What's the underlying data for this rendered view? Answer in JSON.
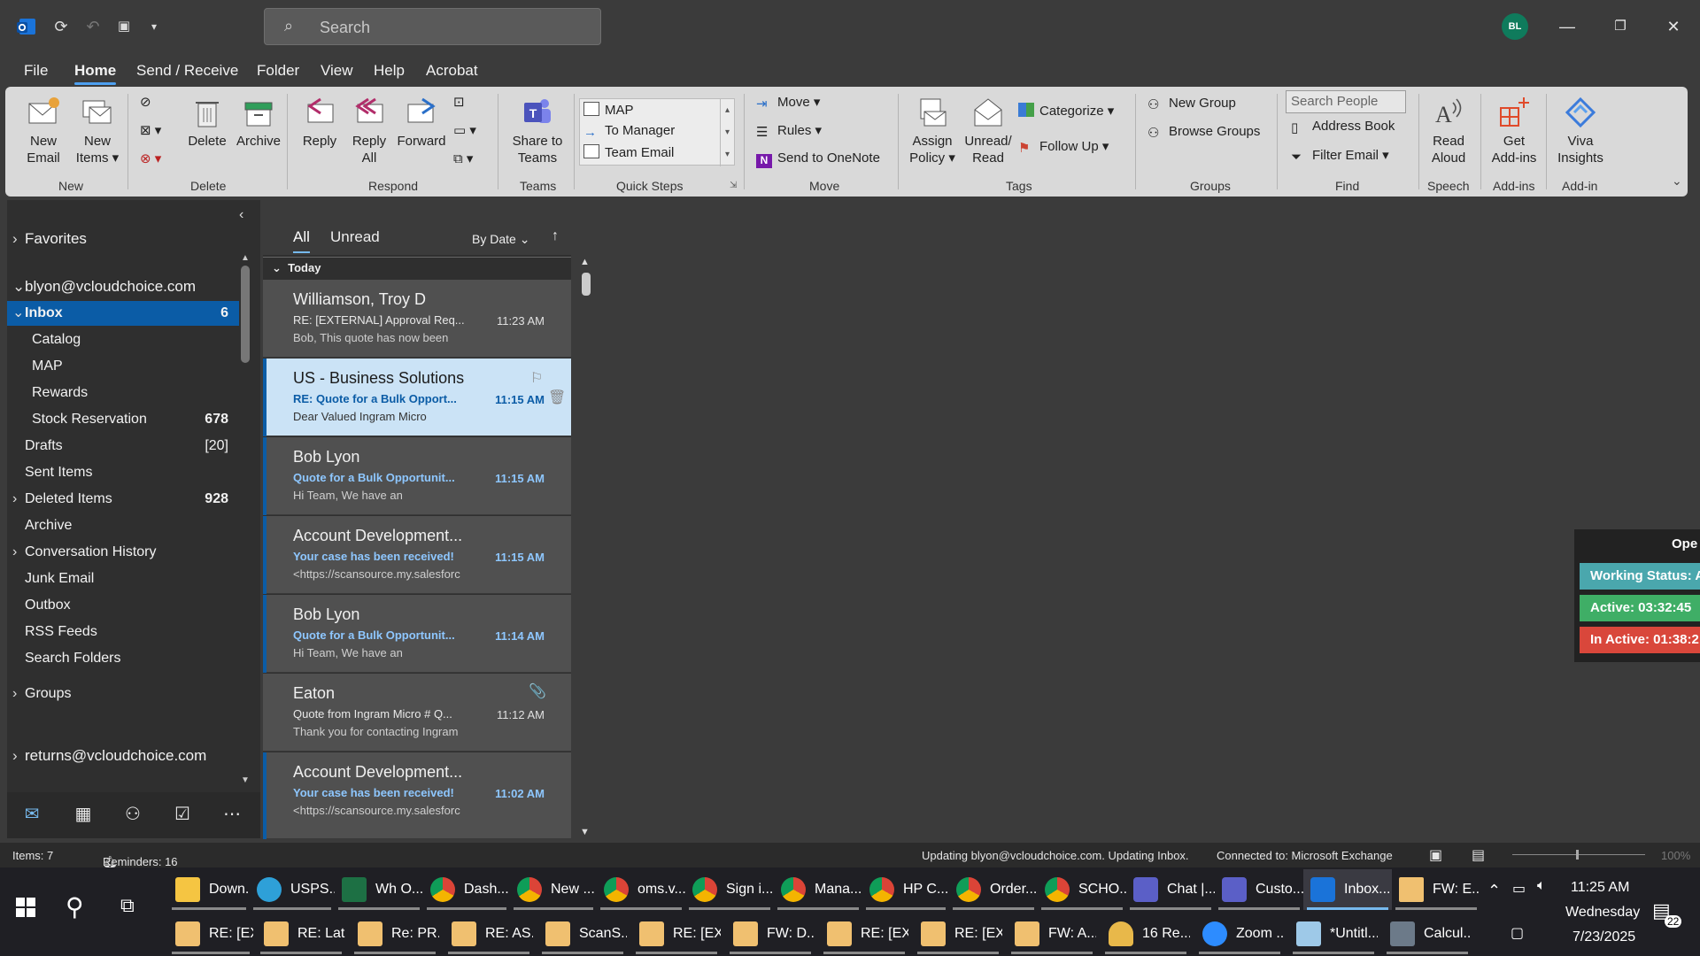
{
  "titlebar": {
    "search_placeholder": "Search",
    "avatar_initials": "BL"
  },
  "menu": [
    "File",
    "Home",
    "Send / Receive",
    "Folder",
    "View",
    "Help",
    "Acrobat"
  ],
  "ribbon": {
    "new_email": "New Email",
    "new_email_l1": "New",
    "new_email_l2": "Email",
    "new_items_l1": "New",
    "new_items_l2": "Items",
    "group_new": "New",
    "delete": "Delete",
    "archive": "Archive",
    "group_delete": "Delete",
    "reply": "Reply",
    "reply_all_l1": "Reply",
    "reply_all_l2": "All",
    "forward": "Forward",
    "group_respond": "Respond",
    "share_teams_l1": "Share to",
    "share_teams_l2": "Teams",
    "group_teams": "Teams",
    "quick_steps": [
      "MAP",
      "To Manager",
      "Team Email"
    ],
    "group_quick_steps": "Quick Steps",
    "move": "Move",
    "rules": "Rules",
    "send_onenote": "Send to OneNote",
    "group_move": "Move",
    "assign_policy_l1": "Assign",
    "assign_policy_l2": "Policy",
    "unread_read_l1": "Unread/",
    "unread_read_l2": "Read",
    "categorize": "Categorize",
    "follow_up": "Follow Up",
    "group_tags": "Tags",
    "new_group": "New Group",
    "browse_groups": "Browse Groups",
    "group_groups": "Groups",
    "search_people": "Search People",
    "address_book": "Address Book",
    "filter_email": "Filter Email",
    "group_find": "Find",
    "read_aloud_l1": "Read",
    "read_aloud_l2": "Aloud",
    "group_speech": "Speech",
    "get_addins_l1": "Get",
    "get_addins_l2": "Add-ins",
    "group_addins": "Add-ins",
    "viva_l1": "Viva",
    "viva_l2": "Insights",
    "group_addin": "Add-in"
  },
  "folders": {
    "favorites": "Favorites",
    "account1": "blyon@vcloudchoice.com",
    "items": [
      {
        "label": "Inbox",
        "count": "6"
      },
      {
        "label": "Catalog",
        "count": ""
      },
      {
        "label": "MAP",
        "count": ""
      },
      {
        "label": "Rewards",
        "count": ""
      },
      {
        "label": "Stock Reservation",
        "count": "678"
      },
      {
        "label": "Drafts",
        "count": "[20]"
      },
      {
        "label": "Sent Items",
        "count": ""
      },
      {
        "label": "Deleted Items",
        "count": "928"
      },
      {
        "label": "Archive",
        "count": ""
      },
      {
        "label": "Conversation History",
        "count": ""
      },
      {
        "label": "Junk Email",
        "count": ""
      },
      {
        "label": "Outbox",
        "count": ""
      },
      {
        "label": "RSS Feeds",
        "count": ""
      },
      {
        "label": "Search Folders",
        "count": ""
      }
    ],
    "groups": "Groups",
    "account2": "returns@vcloudchoice.com"
  },
  "list": {
    "tab_all": "All",
    "tab_unread": "Unread",
    "sort": "By Date",
    "group_today": "Today",
    "messages": [
      {
        "from": "Williamson, Troy D",
        "subject": "RE: [EXTERNAL] Approval Req...",
        "time": "11:23 AM",
        "preview": "Bob,  This quote has now been"
      },
      {
        "from": "US - Business Solutions",
        "subject": "RE: Quote for a Bulk Opport...",
        "time": "11:15 AM",
        "preview": "Dear Valued Ingram Micro"
      },
      {
        "from": "Bob Lyon",
        "subject": "Quote for a Bulk Opportunit...",
        "time": "11:15 AM",
        "preview": "Hi Team,  We have an"
      },
      {
        "from": "Account Development...",
        "subject": "Your case has been received!",
        "time": "11:15 AM",
        "preview": "<https://scansource.my.salesforc"
      },
      {
        "from": "Bob Lyon",
        "subject": "Quote for a Bulk Opportunit...",
        "time": "11:14 AM",
        "preview": "Hi Team,  We have an"
      },
      {
        "from": "Eaton",
        "subject": "Quote from Ingram Micro # Q...",
        "time": "11:12 AM",
        "preview": "Thank you for contacting Ingram"
      },
      {
        "from": "Account Development...",
        "subject": "Your case has been received!",
        "time": "11:02 AM",
        "preview": "<https://scansource.my.salesforc"
      }
    ]
  },
  "timer": {
    "header": "Ope",
    "working_status": "Working Status: A",
    "active": "Active: 03:32:45",
    "inactive": "In Active: 01:38:2"
  },
  "status": {
    "items": "Items: 7",
    "reminders": "Reminders: 16",
    "updating": "Updating blyon@vcloudchoice.com.  Updating Inbox.",
    "connected": "Connected to: Microsoft Exchange",
    "zoom": "100%"
  },
  "taskbar": {
    "row1": [
      "Down...",
      "USPS...",
      "Wh O...",
      "Dash...",
      "New ...",
      "oms.v...",
      "Sign i...",
      "Mana...",
      "HP C...",
      "Order...",
      "SCHO...",
      "Chat |...",
      "Custo...",
      "Inbox...",
      "FW: E..."
    ],
    "row2": [
      "RE: [EX...",
      "RE: Lat...",
      "Re: PR...",
      "RE: AS...",
      "ScanS...",
      "RE: [EX...",
      "FW: D...",
      "RE: [EX...",
      "RE: [EX...",
      "FW: A...",
      "16 Re...",
      "Zoom ...",
      "*Untitl...",
      "Calcul..."
    ],
    "time": "11:25 AM",
    "day": "Wednesday",
    "date": "7/23/2025",
    "notif_count": "22"
  },
  "colors": {
    "accent": "#0b5ca6",
    "unread": "#8ec7ff",
    "working": "#4aa7ad",
    "active": "#3fae66",
    "inactive": "#d9473b"
  }
}
